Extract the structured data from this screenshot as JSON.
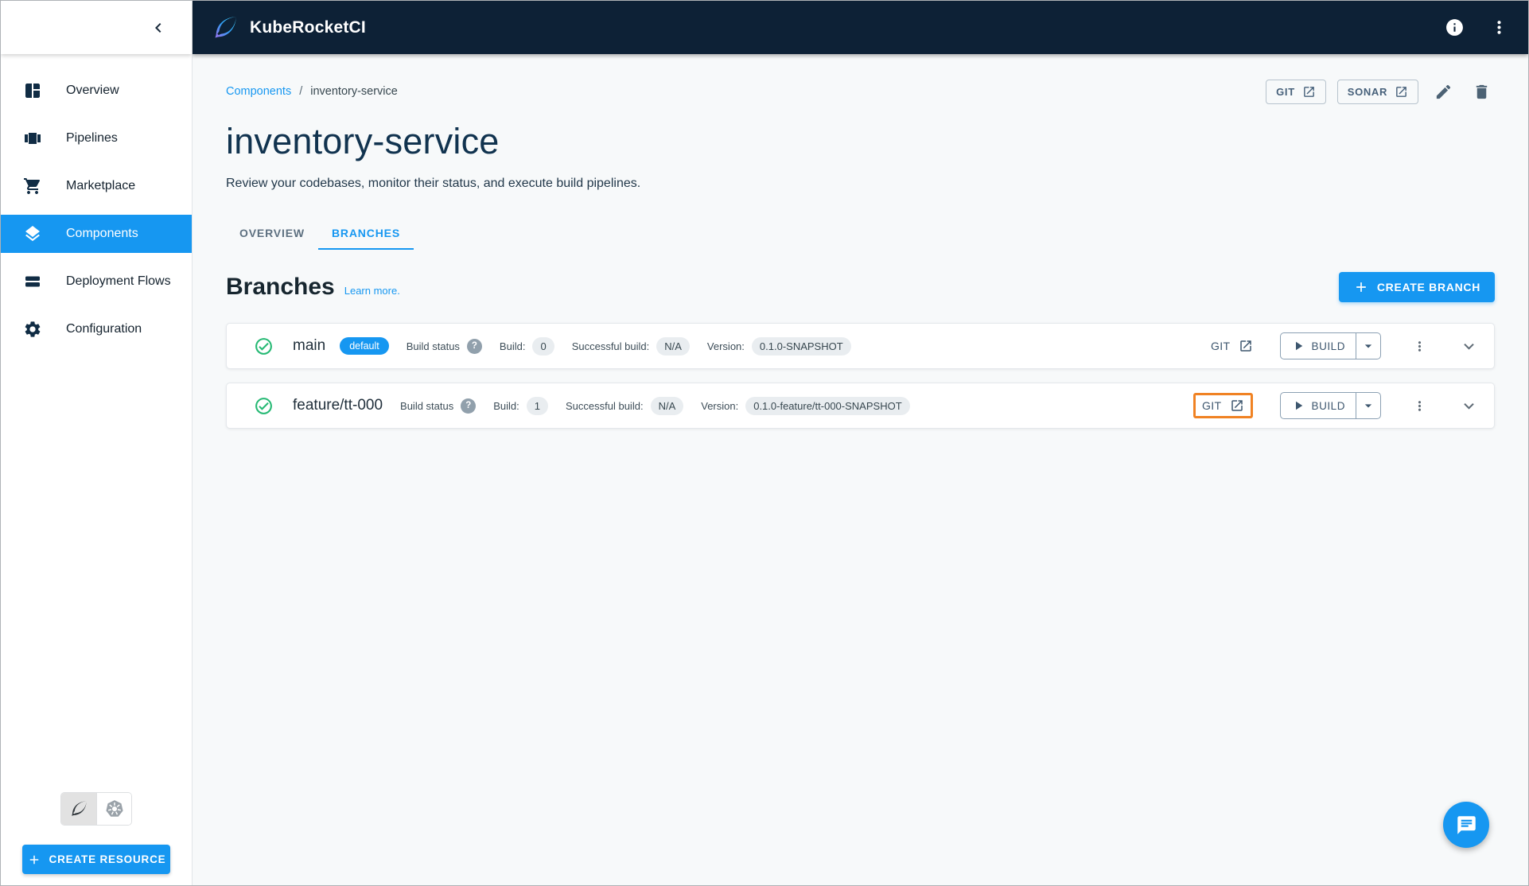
{
  "header": {
    "app_name": "KubeRocketCI"
  },
  "sidebar": {
    "items": [
      {
        "label": "Overview"
      },
      {
        "label": "Pipelines"
      },
      {
        "label": "Marketplace"
      },
      {
        "label": "Components"
      },
      {
        "label": "Deployment Flows"
      },
      {
        "label": "Configuration"
      }
    ],
    "create_resource_label": "CREATE RESOURCE"
  },
  "breadcrumb": {
    "parent": "Components",
    "separator": "/",
    "current": "inventory-service"
  },
  "page": {
    "title": "inventory-service",
    "subtitle": "Review your codebases, monitor their status, and execute build pipelines.",
    "git_button": "GIT",
    "sonar_button": "SONAR"
  },
  "tabs": {
    "overview": "OVERVIEW",
    "branches": "BRANCHES"
  },
  "branches": {
    "heading": "Branches",
    "learn_more_label": "Learn more.",
    "create_branch_label": "CREATE BRANCH",
    "labels": {
      "build_status": "Build status",
      "help": "?",
      "build": "Build:",
      "successful_build": "Successful build:",
      "version": "Version:",
      "git": "GIT",
      "build_button": "BUILD"
    },
    "rows": [
      {
        "name": "main",
        "default_badge": "default",
        "build_count": "0",
        "successful_build": "N/A",
        "version": "0.1.0-SNAPSHOT"
      },
      {
        "name": "feature/tt-000",
        "build_count": "1",
        "successful_build": "N/A",
        "version": "0.1.0-feature/tt-000-SNAPSHOT"
      }
    ]
  },
  "colors": {
    "accent_blue": "#1697f1",
    "header_navy": "#0d2136",
    "success_green": "#26b974",
    "highlight_orange": "#f08223",
    "chip_gray": "#e9edf0"
  }
}
